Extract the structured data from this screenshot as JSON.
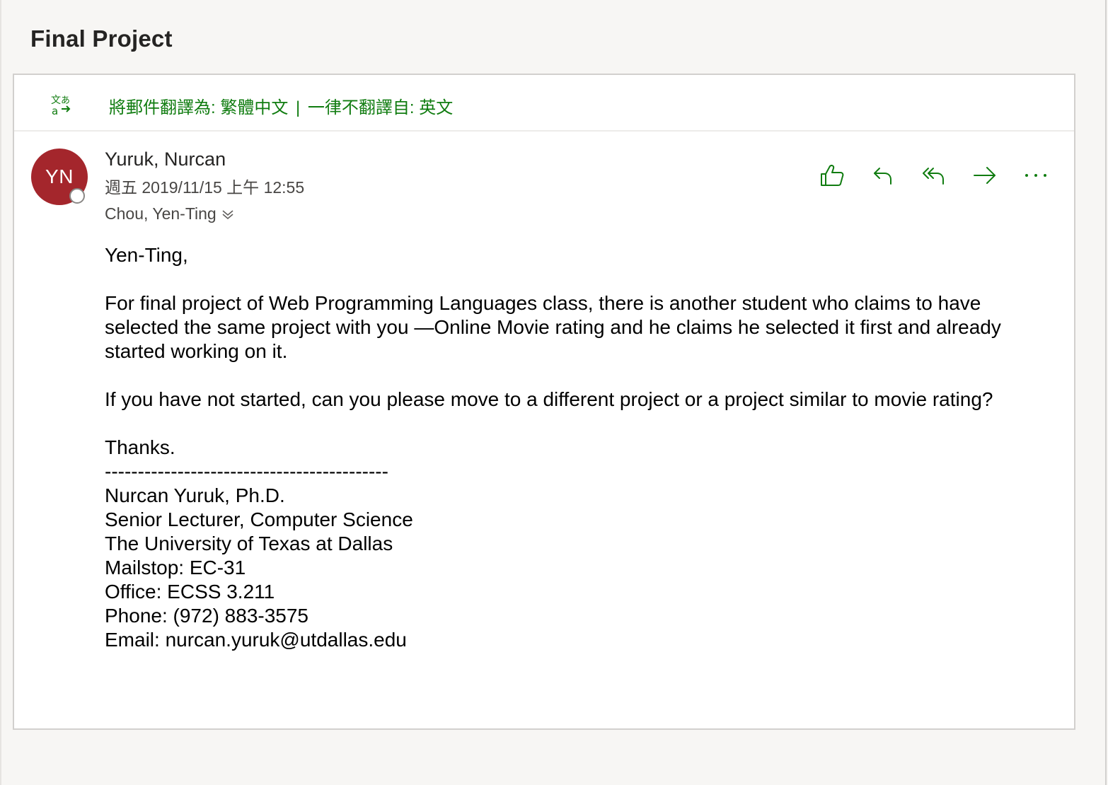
{
  "subject": "Final Project",
  "translate_bar": {
    "icon": "translate-icon",
    "translate_link": "將郵件翻譯為: 繁體中文",
    "separator": "|",
    "never_translate_link": "一律不翻譯自: 英文"
  },
  "message": {
    "avatar_initials": "YN",
    "avatar_color": "#a4262c",
    "sender": "Yuruk, Nurcan",
    "date": "週五 2019/11/15 上午 12:55",
    "recipients": "Chou, Yen-Ting"
  },
  "actions": [
    {
      "name": "like",
      "icon": "thumbs-up-icon"
    },
    {
      "name": "reply",
      "icon": "reply-icon"
    },
    {
      "name": "reply-all",
      "icon": "reply-all-icon"
    },
    {
      "name": "forward",
      "icon": "forward-icon"
    },
    {
      "name": "more",
      "icon": "more-icon"
    }
  ],
  "body": {
    "greeting": "Yen-Ting,",
    "paragraph1": "For final project of Web Programming Languages class, there is another student who claims to have selected the same project with you —Online Movie rating and he claims he selected it first and already started working on it.",
    "paragraph2": "If you have not started, can you please move to a different project or a project similar to movie rating?",
    "closing": "Thanks.",
    "signature": {
      "divider": "-------------------------------------------",
      "name": "Nurcan Yuruk, Ph.D.",
      "title": "Senior Lecturer, Computer Science",
      "university": "The University of Texas at Dallas",
      "mailstop": "Mailstop:  EC-31",
      "office": "Office: ECSS 3.211",
      "phone": "Phone: (972) 883-3575",
      "email": "Email: nurcan.yuruk@utdallas.edu"
    }
  },
  "accent_color": "#107c10"
}
